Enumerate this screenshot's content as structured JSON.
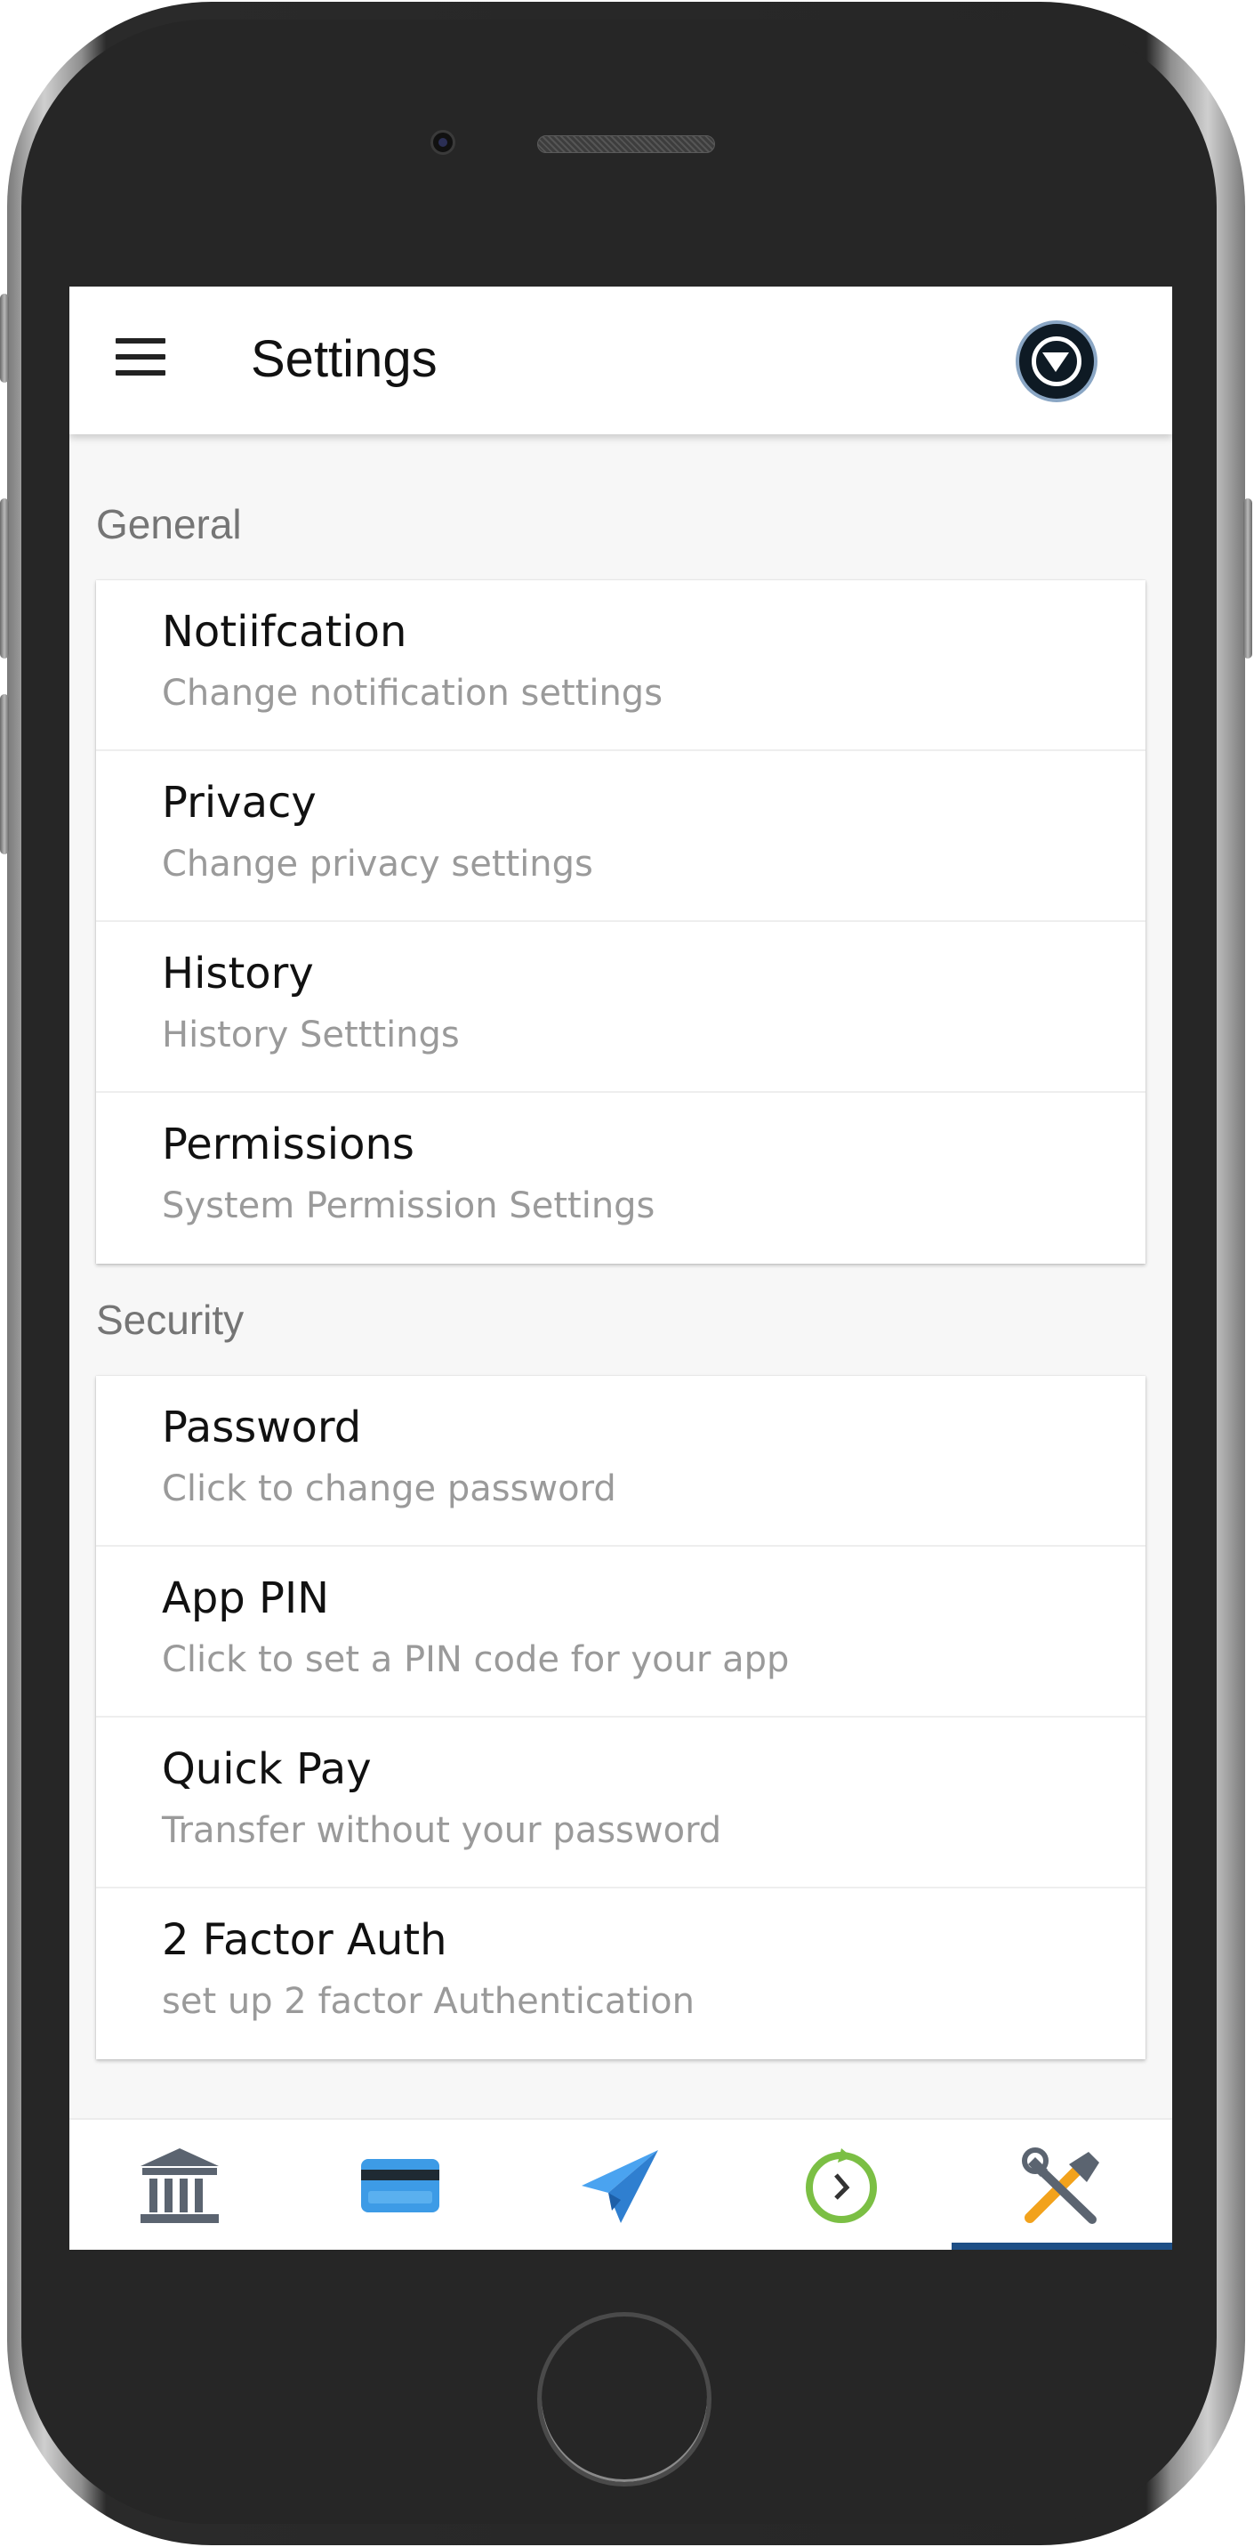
{
  "app_bar": {
    "title": "Settings",
    "menu_icon": "hamburger-menu-icon",
    "profile_icon": "profile-dropdown-icon"
  },
  "sections": [
    {
      "label": "General",
      "items": [
        {
          "title": "Notiifcation",
          "subtitle": "Change notification settings"
        },
        {
          "title": "Privacy",
          "subtitle": "Change privacy settings"
        },
        {
          "title": "History",
          "subtitle": "History Setttings"
        },
        {
          "title": "Permissions",
          "subtitle": "System Permission Settings"
        }
      ]
    },
    {
      "label": "Security",
      "items": [
        {
          "title": "Password",
          "subtitle": "Click to change password"
        },
        {
          "title": "App PIN",
          "subtitle": "Click to set a PIN code for your app"
        },
        {
          "title": "Quick Pay",
          "subtitle": "Transfer without your password"
        },
        {
          "title": "2 Factor Auth",
          "subtitle": "set up 2 factor Authentication"
        }
      ]
    }
  ],
  "bottom_nav": {
    "tabs": [
      {
        "icon": "bank-icon"
      },
      {
        "icon": "credit-card-icon"
      },
      {
        "icon": "send-paper-plane-icon"
      },
      {
        "icon": "history-clock-icon"
      },
      {
        "icon": "tools-settings-icon",
        "active": true
      }
    ],
    "active_color": "#1e4f86"
  }
}
